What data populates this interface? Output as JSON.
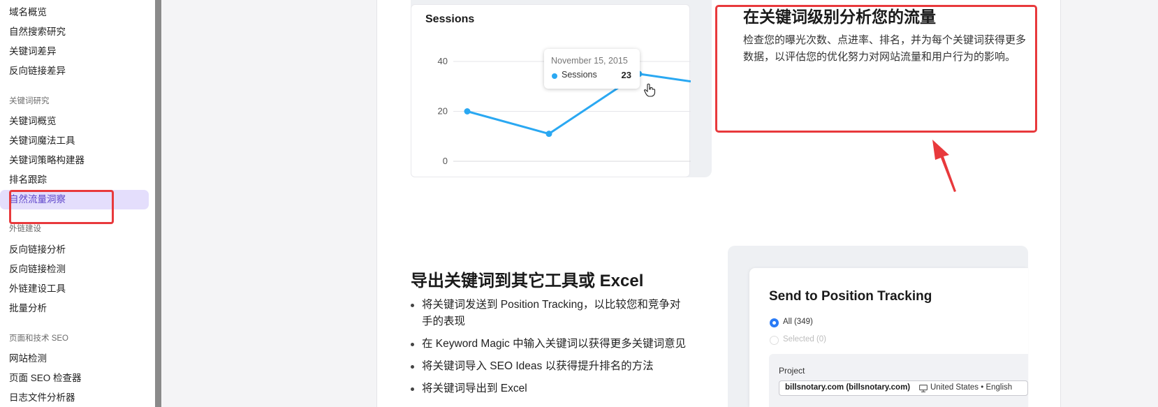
{
  "sidebar": {
    "top_items": [
      "域名概览",
      "自然搜索研究",
      "关键词差异",
      "反向链接差异"
    ],
    "keyword_research": {
      "title": "关键词研究",
      "items": [
        "关键词概览",
        "关键词魔法工具",
        "关键词策略构建器",
        "排名跟踪",
        "自然流量洞察"
      ]
    },
    "link_building": {
      "title": "外链建设",
      "items": [
        "反向链接分析",
        "反向链接检测",
        "外链建设工具",
        "批量分析"
      ]
    },
    "onpage_seo": {
      "title": "页面和技术 SEO",
      "items": [
        "网站检测",
        "页面 SEO 检查器",
        "日志文件分析器"
      ]
    },
    "active_item": "自然流量洞察"
  },
  "chart": {
    "title": "Sessions",
    "tooltip": {
      "date": "November 15, 2015",
      "series": "Sessions",
      "value": "23"
    }
  },
  "chart_data": {
    "type": "line",
    "title": "Sessions",
    "xlabel": "",
    "ylabel": "",
    "ylim": [
      0,
      40
    ],
    "yticks": [
      "40",
      "20",
      "0"
    ],
    "grid": true,
    "series": [
      {
        "name": "Sessions",
        "values": [
          20,
          11,
          35,
          32
        ]
      }
    ],
    "color": "#2aa8f2"
  },
  "feature": {
    "title": "在关键词级别分析您的流量",
    "description": "检查您的曝光次数、点进率、排名，并为每个关键词获得更多数据，以评估您的优化努力对网站流量和用户行为的影响。"
  },
  "export": {
    "title": "导出关键词到其它工具或 Excel",
    "bullets": [
      "将关键词发送到 Position Tracking，以比较您和竞争对手的表现",
      "在 Keyword Magic 中输入关键词以获得更多关键词意见",
      "将关键词导入 SEO Ideas 以获得提升排名的方法",
      "将关键词导出到 Excel"
    ]
  },
  "position_tracking": {
    "title": "Send to Position Tracking",
    "option_all": "All (349)",
    "option_selected": "Selected (0)",
    "project_label": "Project",
    "project_value": "billsnotary.com (billsnotary.com)",
    "region": "United States • English"
  },
  "colors": {
    "accent": "#5b43c9",
    "annotation": "#e8393c",
    "series": "#2aa8f2",
    "radio": "#2a7bf6"
  }
}
